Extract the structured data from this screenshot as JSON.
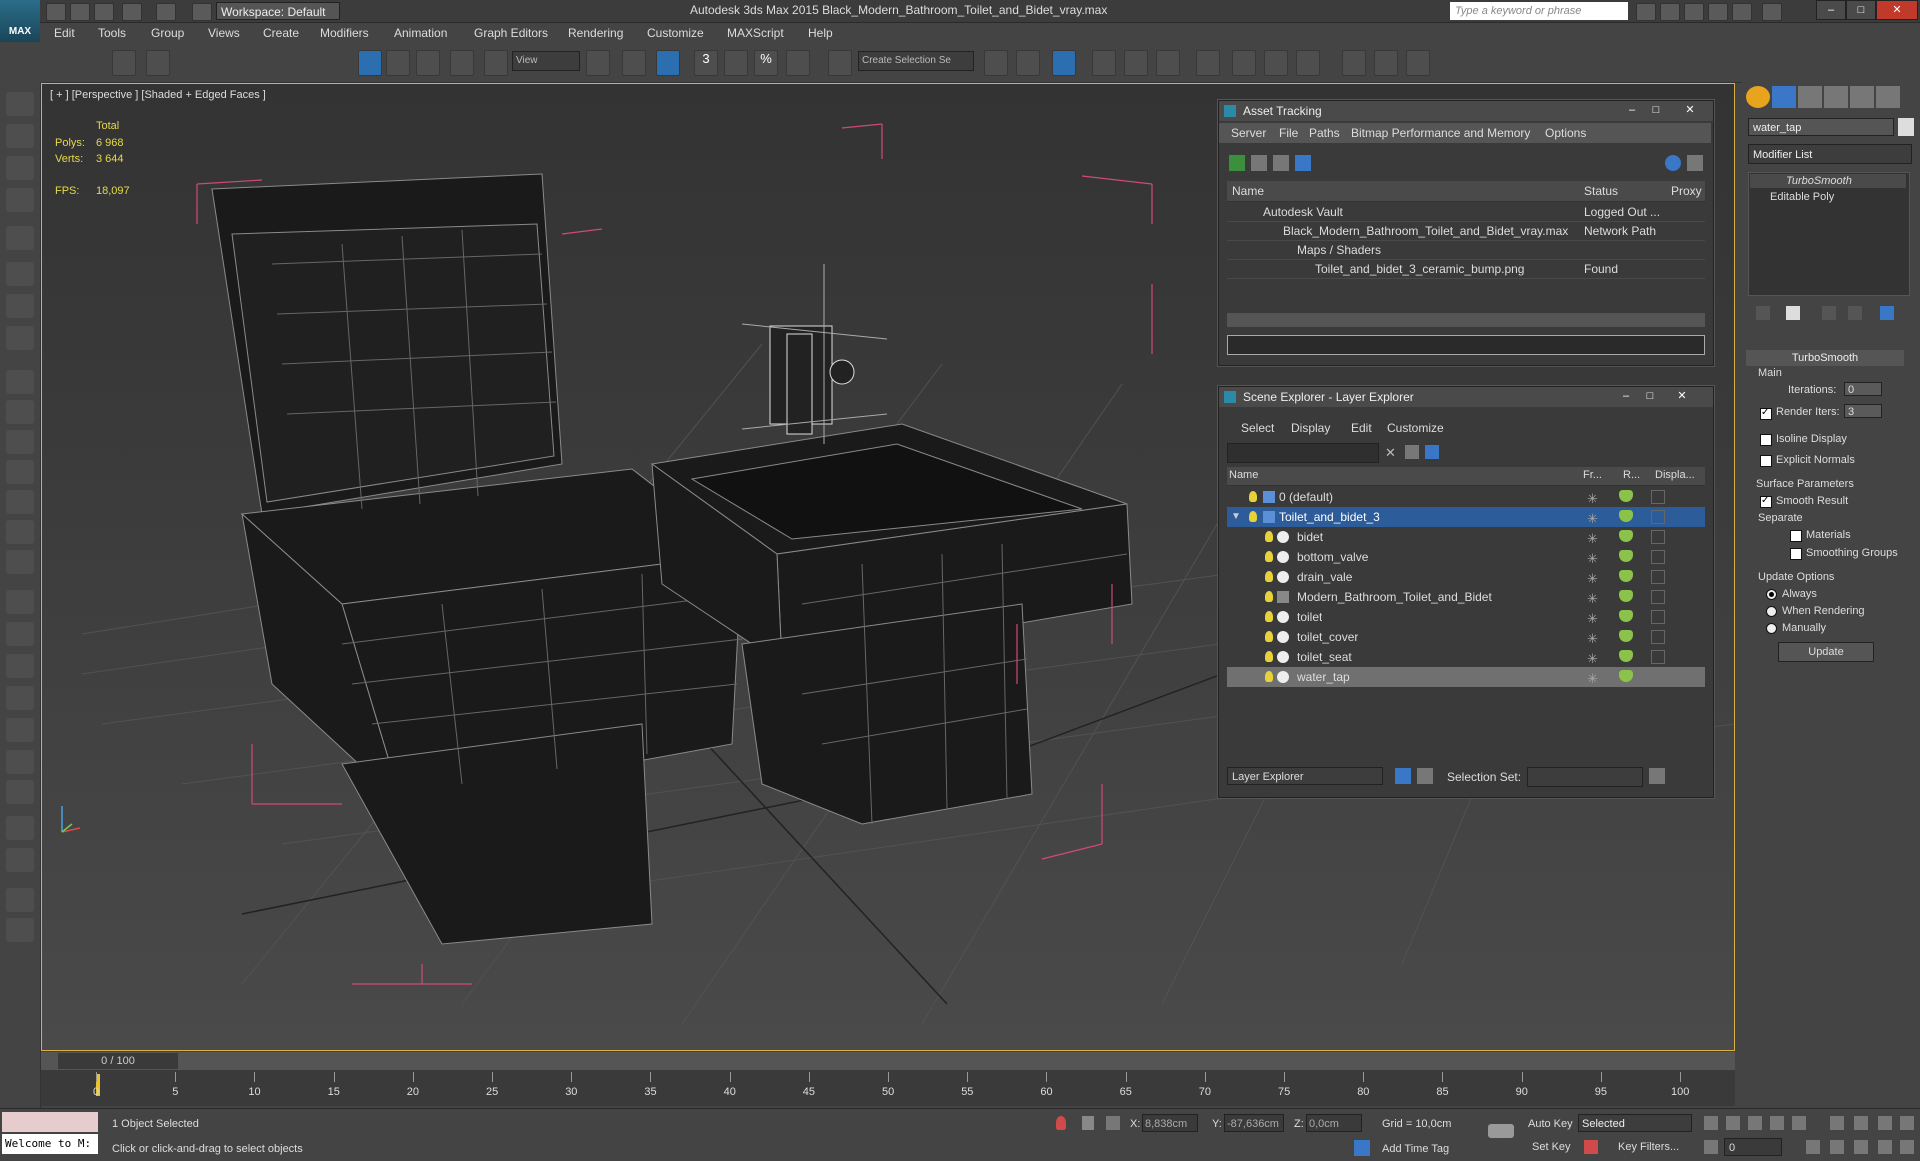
{
  "window": {
    "title": "Autodesk 3ds Max 2015    Black_Modern_Bathroom_Toilet_and_Bidet_vray.max",
    "workspace": "Workspace: Default",
    "search_placeholder": "Type a keyword or phrase",
    "logo": "MAX"
  },
  "menu": [
    "Edit",
    "Tools",
    "Group",
    "Views",
    "Create",
    "Modifiers",
    "Animation",
    "Graph Editors",
    "Rendering",
    "Customize",
    "MAXScript",
    "Help"
  ],
  "toolbar": {
    "view_dropdown": "View",
    "selection_set": "Create Selection Se",
    "snap_3": "3",
    "snap_pct": "%"
  },
  "viewport": {
    "label": "[ + ] [Perspective ] [Shaded + Edged Faces ]",
    "stats": {
      "total_label": "Total",
      "polys_label": "Polys:",
      "polys_value": "6 968",
      "verts_label": "Verts:",
      "verts_value": "3 644",
      "fps_label": "FPS:",
      "fps_value": "18,097"
    }
  },
  "asset_tracking": {
    "title": "Asset Tracking",
    "menu": [
      "Server",
      "File",
      "Paths",
      "Bitmap Performance and Memory",
      "Options"
    ],
    "columns": [
      "Name",
      "Status",
      "Proxy"
    ],
    "rows": [
      {
        "name": "Autodesk Vault",
        "status": "Logged Out ...",
        "proxy": ""
      },
      {
        "name": "Black_Modern_Bathroom_Toilet_and_Bidet_vray.max",
        "status": "Network Path",
        "proxy": ""
      },
      {
        "name": "Maps / Shaders",
        "status": "",
        "proxy": ""
      },
      {
        "name": "Toilet_and_bidet_3_ceramic_bump.png",
        "status": "Found",
        "proxy": ""
      }
    ]
  },
  "scene_explorer": {
    "title": "Scene Explorer - Layer Explorer",
    "menu": [
      "Select",
      "Display",
      "Edit",
      "Customize"
    ],
    "columns": [
      "Name",
      "Fr...",
      "R...",
      "Displa..."
    ],
    "rows": [
      {
        "name": "0 (default)",
        "level": 0,
        "type": "layer"
      },
      {
        "name": "Toilet_and_bidet_3",
        "level": 0,
        "type": "layer"
      },
      {
        "name": "bidet",
        "level": 1,
        "type": "object"
      },
      {
        "name": "bottom_valve",
        "level": 1,
        "type": "object"
      },
      {
        "name": "drain_vale",
        "level": 1,
        "type": "object"
      },
      {
        "name": "Modern_Bathroom_Toilet_and_Bidet",
        "level": 1,
        "type": "group"
      },
      {
        "name": "toilet",
        "level": 1,
        "type": "object"
      },
      {
        "name": "toilet_cover",
        "level": 1,
        "type": "object"
      },
      {
        "name": "toilet_seat",
        "level": 1,
        "type": "object"
      },
      {
        "name": "water_tap",
        "level": 1,
        "type": "object"
      }
    ],
    "footer_mode": "Layer Explorer",
    "selection_set_label": "Selection Set:"
  },
  "command_panel": {
    "object_name": "water_tap",
    "modifier_list": "Modifier List",
    "stack": [
      "TurboSmooth",
      "Editable Poly"
    ],
    "rollout_title": "TurboSmooth",
    "main_label": "Main",
    "iterations_label": "Iterations:",
    "iterations_value": "0",
    "render_iters_label": "Render Iters:",
    "render_iters_value": "3",
    "isoline_label": "Isoline Display",
    "explicit_normals_label": "Explicit Normals",
    "surface_params_label": "Surface Parameters",
    "smooth_result_label": "Smooth Result",
    "separate_label": "Separate",
    "materials_label": "Materials",
    "smoothing_groups_label": "Smoothing Groups",
    "update_options_label": "Update Options",
    "always_label": "Always",
    "when_rendering_label": "When Rendering",
    "manually_label": "Manually",
    "update_button": "Update"
  },
  "timeline": {
    "frame_display": "0 / 100",
    "ticks": [
      "0",
      "5",
      "10",
      "15",
      "20",
      "25",
      "30",
      "35",
      "40",
      "45",
      "50",
      "55",
      "60",
      "65",
      "70",
      "75",
      "80",
      "85",
      "90",
      "95",
      "100"
    ]
  },
  "status": {
    "welcome": "Welcome to M:",
    "selected": "1 Object Selected",
    "hint": "Click or click-and-drag to select objects",
    "x_label": "X:",
    "x_value": "8,838cm",
    "y_label": "Y:",
    "y_value": "-87,636cm",
    "z_label": "Z:",
    "z_value": "0,0cm",
    "grid": "Grid = 10,0cm",
    "add_time_tag": "Add Time Tag",
    "auto_key": "Auto Key",
    "auto_key_dropdown": "Selected",
    "set_key": "Set Key",
    "key_filters": "Key Filters...",
    "current_frame": "0"
  }
}
